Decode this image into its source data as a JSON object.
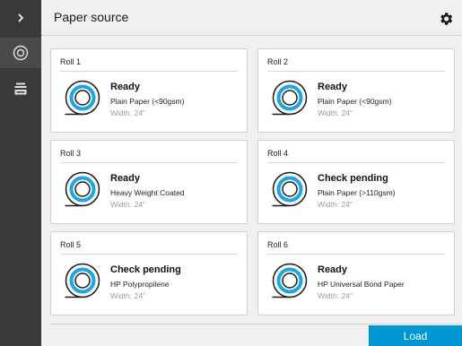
{
  "sidebar": {
    "items": [
      {
        "icon": "chevron-right-icon"
      },
      {
        "icon": "paper-roll-icon"
      },
      {
        "icon": "paper-tray-icon"
      }
    ]
  },
  "header": {
    "title": "Paper source",
    "settings_icon": "gear-icon"
  },
  "rolls": [
    {
      "name": "Roll 1",
      "status": "Ready",
      "media": "Plain Paper (<90gsm)",
      "width": "Width: 24\""
    },
    {
      "name": "Roll 2",
      "status": "Ready",
      "media": "Plain Paper (<90gsm)",
      "width": "Width: 24\""
    },
    {
      "name": "Roll 3",
      "status": "Ready",
      "media": "Heavy Weight Coated",
      "width": "Width: 24\""
    },
    {
      "name": "Roll 4",
      "status": "Check pending",
      "media": "Plain Paper (>110gsm)",
      "width": "Width: 24\""
    },
    {
      "name": "Roll 5",
      "status": "Check pending",
      "media": "HP Polypropilene",
      "width": "Width: 24\""
    },
    {
      "name": "Roll 6",
      "status": "Ready",
      "media": "HP Universal Bond Paper",
      "width": "Width: 24\""
    }
  ],
  "footer": {
    "load_label": "Load"
  },
  "colors": {
    "accent": "#0096d6",
    "sidebar": "#3a3a3a",
    "roll_ring": "#1ba8e0"
  }
}
